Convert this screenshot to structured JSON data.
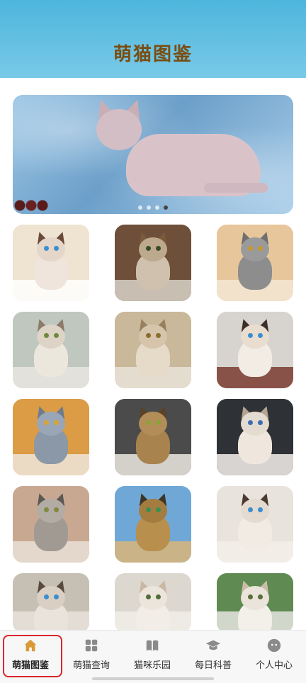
{
  "header": {
    "title": "萌猫图鉴"
  },
  "banner": {
    "dots_total": 4,
    "active_dot": 3
  },
  "cards": [
    {
      "bg": "#efe3d2",
      "floor": "#ffffff",
      "fur": "#efe5dc",
      "head": "#e4d6c9",
      "ear": "#6b4a3a",
      "eye": "#3a8fd0"
    },
    {
      "bg": "#6e4f3a",
      "floor": "#d8d2c8",
      "fur": "#cfc1ad",
      "head": "#bda98d",
      "ear": "#7a5a3b",
      "eye": "#3b4b2a"
    },
    {
      "bg": "#e8c69b",
      "floor": "#f3e6d3",
      "fur": "#8d8d8d",
      "head": "#9a9a9a",
      "ear": "#6f6f6f",
      "eye": "#c79a2e"
    },
    {
      "bg": "#bfc7bf",
      "floor": "#e9e5df",
      "fur": "#ece7dd",
      "head": "#ddd3c6",
      "ear": "#8c7b6a",
      "eye": "#6f8a3a"
    },
    {
      "bg": "#c9b89a",
      "floor": "#e9e3d8",
      "fur": "#e6dbc9",
      "head": "#d6c5aa",
      "ear": "#9a7f5f",
      "eye": "#8a6d2f"
    },
    {
      "bg": "#d7d3cf",
      "floor": "#7a3b30",
      "fur": "#f2ece4",
      "head": "#e9ddd0",
      "ear": "#3e2e28",
      "eye": "#3a8fd0"
    },
    {
      "bg": "#dc9b45",
      "floor": "#efe6db",
      "fur": "#8b98a8",
      "head": "#9aa6b5",
      "ear": "#6f7c8c",
      "eye": "#d6a437"
    },
    {
      "bg": "#4b4b4b",
      "floor": "#ece8e0",
      "fur": "#a8834e",
      "head": "#b28d58",
      "ear": "#5a4228",
      "eye": "#8aa43a"
    },
    {
      "bg": "#2e3136",
      "floor": "#f4f1ec",
      "fur": "#efe7de",
      "head": "#e5dcd1",
      "ear": "#b3a391",
      "eye": "#3f6fb0"
    },
    {
      "bg": "#c9a892",
      "floor": "#e9e0d6",
      "fur": "#a09a93",
      "head": "#b3aca4",
      "ear": "#5d5852",
      "eye": "#7f8a3f"
    },
    {
      "bg": "#6fa8d6",
      "floor": "#d9b579",
      "fur": "#b88f4d",
      "head": "#a47c3f",
      "ear": "#3f3527",
      "eye": "#3b8f4f"
    },
    {
      "bg": "#e8e3dc",
      "floor": "#f3efe9",
      "fur": "#f1ebe3",
      "head": "#e4dad0",
      "ear": "#4b3a30",
      "eye": "#3a8fd0"
    },
    {
      "bg": "#c6c0b4",
      "floor": "#e7e2db",
      "fur": "#e9e3dc",
      "head": "#d9cfc3",
      "ear": "#5a4a3d",
      "eye": "#3a8fd0"
    },
    {
      "bg": "#dcd7cf",
      "floor": "#f1ede8",
      "fur": "#f2ede6",
      "head": "#ece5dc",
      "ear": "#c9b7a3",
      "eye": "#4f6f3a"
    },
    {
      "bg": "#5f8a52",
      "floor": "#e6e4e0",
      "fur": "#f3efe9",
      "head": "#ebe4da",
      "ear": "#cbbca8",
      "eye": "#5b6f3a"
    }
  ],
  "tabs": [
    {
      "label": "萌猫图鉴",
      "icon": "home-icon",
      "active": true
    },
    {
      "label": "萌猫查询",
      "icon": "grid-icon",
      "active": false
    },
    {
      "label": "猫咪乐园",
      "icon": "book-icon",
      "active": false
    },
    {
      "label": "每日科普",
      "icon": "graduation-cap-icon",
      "active": false
    },
    {
      "label": "个人中心",
      "icon": "chat-bubble-icon",
      "active": false
    }
  ],
  "colors": {
    "header_bg": "#5bbce0",
    "title": "#7a4e12",
    "home_icon": "#d89a36",
    "tab_icon": "#8a8a8a",
    "highlight": "#d9262c"
  }
}
